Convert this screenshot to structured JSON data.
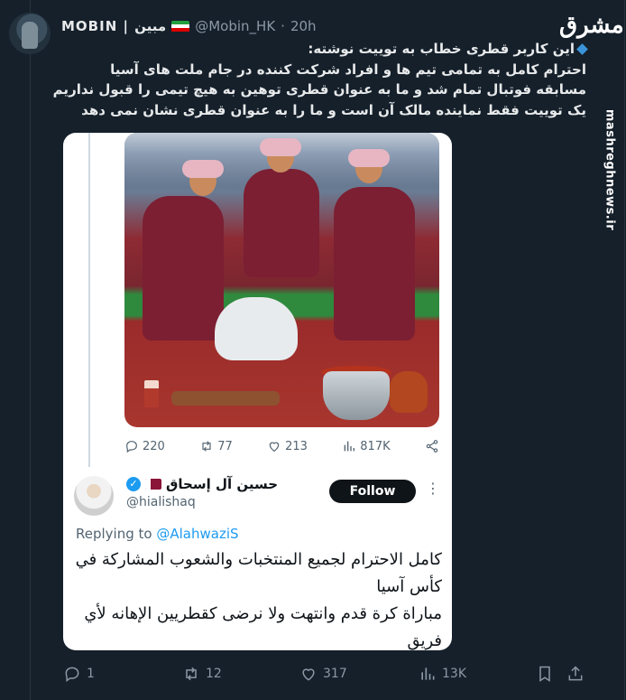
{
  "tweet": {
    "display_name": "MOBIN | مبین",
    "handle": "@Mobin_HK",
    "dot": "·",
    "time": "20h",
    "more": "···",
    "text_lines": [
      "این کاربر قطری خطاب به توییت نوشته:",
      "احترام کامل به تمامی تیم ها و افراد شرکت کننده در جام ملت های آسیا",
      "مسابقه فوتبال تمام شد و ما به عنوان قطری توهین به هیچ تیمی را قبول نداریم",
      "یک توییت فقط نماینده مالک آن است و ما را به عنوان قطری نشان نمی دهد"
    ],
    "actions": {
      "replies": "1",
      "retweets": "12",
      "likes": "317",
      "views": "13K"
    }
  },
  "watermark": {
    "logo": "مشرق",
    "url": "mashreghnews.ir"
  },
  "embedded_tweet": {
    "actions": {
      "replies": "220",
      "retweets": "77",
      "likes": "213",
      "views": "817K"
    }
  },
  "reply": {
    "name": "حسين آل إسحاق",
    "handle": "@hialishaq",
    "follow_label": "Follow",
    "more": "⋮",
    "replying_prefix": "Replying to",
    "replying_mention": "@AlahwaziS",
    "text_lines": [
      "كامل الاحترام لجميع المنتخبات والشعوب المشاركة في",
      "كأس آسيا",
      "مباراة كرة قدم وانتهت ولا نرضى كقطريين الإهانه لأي",
      "فريق"
    ]
  },
  "colors": {
    "background": "#15202b",
    "accent": "#1d9bf0",
    "muted": "#8b98a5",
    "card": "#ffffff"
  },
  "icons": [
    "reply-icon",
    "retweet-icon",
    "like-icon",
    "views-icon",
    "share-icon",
    "bookmark-icon",
    "verified-icon"
  ]
}
